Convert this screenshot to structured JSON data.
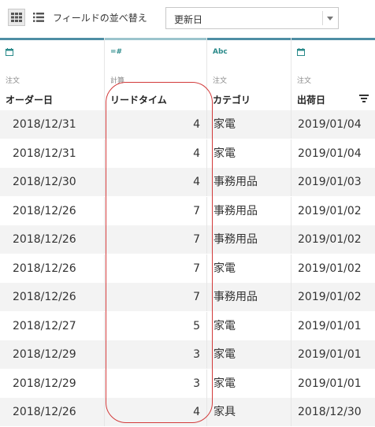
{
  "toolbar": {
    "grid_icon": "grid-view-icon",
    "list_icon": "list-view-icon",
    "sort_fields_label": "フィールドの並べ替え",
    "sort_select_value": "更新日"
  },
  "columns": [
    {
      "type_icon_text": "",
      "type": "date",
      "source": "注文",
      "title": "オーダー日"
    },
    {
      "type_icon_text": "=#",
      "type": "calculated-number",
      "source": "計算",
      "title": "リードタイム"
    },
    {
      "type_icon_text": "Abc",
      "type": "string",
      "source": "注文",
      "title": "カテゴリ"
    },
    {
      "type_icon_text": "",
      "type": "date",
      "source": "注文",
      "title": "出荷日"
    }
  ],
  "rows": [
    {
      "order_date": "2018/12/31",
      "lead_time": "4",
      "category": "家電",
      "ship_date": "2019/01/04"
    },
    {
      "order_date": "2018/12/31",
      "lead_time": "4",
      "category": "家電",
      "ship_date": "2019/01/04"
    },
    {
      "order_date": "2018/12/30",
      "lead_time": "4",
      "category": "事務用品",
      "ship_date": "2019/01/03"
    },
    {
      "order_date": "2018/12/26",
      "lead_time": "7",
      "category": "事務用品",
      "ship_date": "2019/01/02"
    },
    {
      "order_date": "2018/12/26",
      "lead_time": "7",
      "category": "事務用品",
      "ship_date": "2019/01/02"
    },
    {
      "order_date": "2018/12/26",
      "lead_time": "7",
      "category": "家電",
      "ship_date": "2019/01/02"
    },
    {
      "order_date": "2018/12/26",
      "lead_time": "7",
      "category": "事務用品",
      "ship_date": "2019/01/02"
    },
    {
      "order_date": "2018/12/27",
      "lead_time": "5",
      "category": "家電",
      "ship_date": "2019/01/01"
    },
    {
      "order_date": "2018/12/29",
      "lead_time": "3",
      "category": "家電",
      "ship_date": "2019/01/01"
    },
    {
      "order_date": "2018/12/29",
      "lead_time": "3",
      "category": "家電",
      "ship_date": "2019/01/01"
    },
    {
      "order_date": "2018/12/26",
      "lead_time": "4",
      "category": "家具",
      "ship_date": "2018/12/30"
    }
  ],
  "colors": {
    "header_accent": "#4e8ea4",
    "highlight": "#d23a3a",
    "row_alt": "#f3f3f3"
  }
}
